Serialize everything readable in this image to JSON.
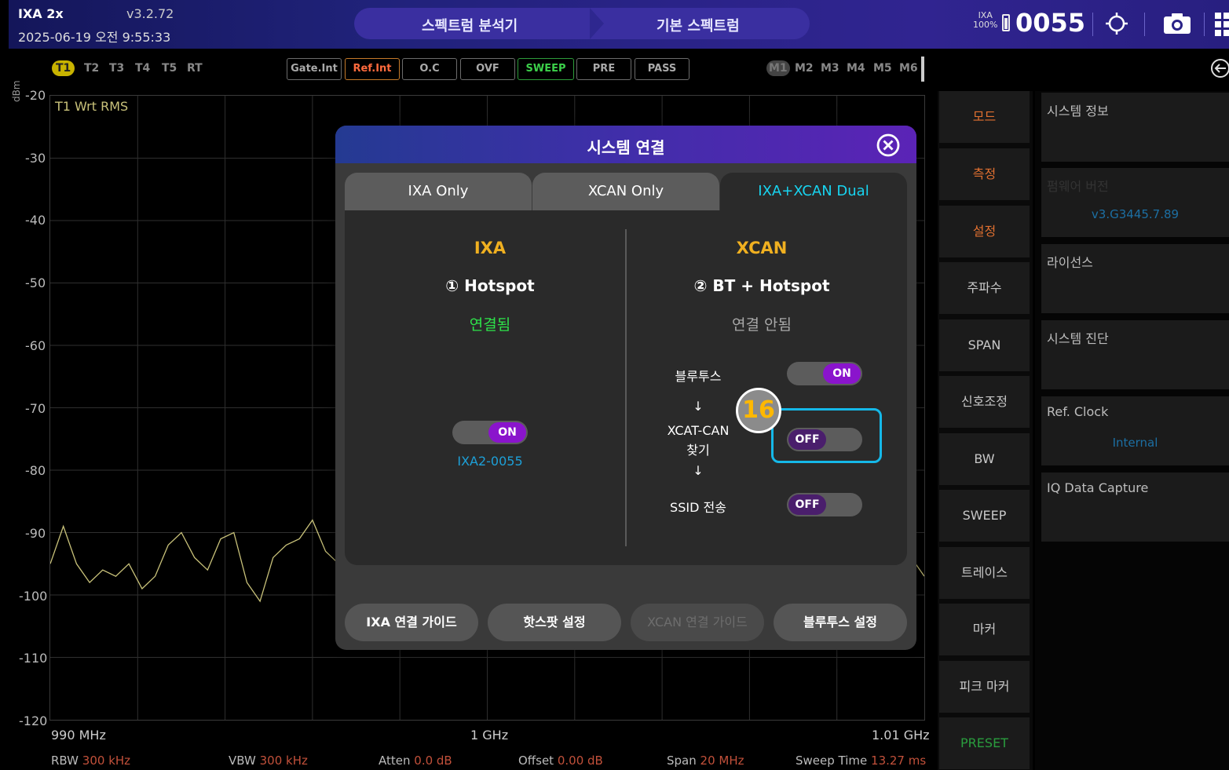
{
  "header": {
    "app_name": "IXA 2x",
    "version": "v3.2.72",
    "datetime": "2025-06-19 오전 9:55:33",
    "breadcrumb": [
      "스펙트럼 분석기",
      "기본 스펙트럼"
    ],
    "ixa_badge": "IXA",
    "battery_percent": "100%",
    "serial": "0055",
    "icons": [
      "battery-icon",
      "target-icon",
      "camera-icon",
      "grid-menu-icon"
    ]
  },
  "chart_toolbar": {
    "traces": [
      "T1",
      "T2",
      "T3",
      "T4",
      "T5",
      "RT"
    ],
    "active_trace": "T1",
    "status": [
      "Gate.Int",
      "Ref.Int",
      "O.C",
      "OVF",
      "SWEEP",
      "PRE",
      "PASS"
    ],
    "markers": [
      "M1",
      "M2",
      "M3",
      "M4",
      "M5",
      "M6"
    ],
    "active_marker": "M1"
  },
  "chart_data": {
    "type": "line",
    "title": "",
    "trace_label": "T1 Wrt RMS",
    "ylabel": "dBm",
    "ylim": [
      -120,
      -20
    ],
    "yticks": [
      "-20",
      "-30",
      "-40",
      "-50",
      "-60",
      "-70",
      "-80",
      "-90",
      "-100",
      "-110",
      "-120"
    ],
    "xticks": [
      "990 MHz",
      "1 GHz",
      "1.01 GHz"
    ],
    "grid": true,
    "series": [
      {
        "x_mhz": [
          990.0,
          990.3,
          990.6,
          990.9,
          991.2,
          991.5,
          991.8,
          992.1,
          992.4,
          992.7,
          993.0,
          993.3,
          993.6,
          993.9,
          994.2,
          994.5,
          994.8,
          995.1,
          995.4,
          995.7,
          996.0,
          996.3,
          996.6,
          996.9,
          997.2,
          997.5,
          997.8,
          998.1,
          998.4,
          998.7,
          999.0,
          999.3,
          999.6,
          1009.0,
          1009.3,
          1009.6,
          1010.0
        ],
        "y_dbm": [
          -95,
          -89,
          -95,
          -98,
          -96,
          -97,
          -95,
          -99,
          -97,
          -92,
          -90,
          -94,
          -96,
          -91,
          -90,
          -98,
          -101,
          -94,
          -92,
          -91,
          -88,
          -93,
          -95,
          -92,
          -97,
          -93,
          -96,
          -99,
          -95,
          -92,
          -89,
          -92,
          -94,
          -92,
          -91,
          -93,
          -97
        ]
      }
    ]
  },
  "footer": {
    "rbw_label": "RBW",
    "rbw": "300 kHz",
    "vbw_label": "VBW",
    "vbw": "300 kHz",
    "atten_label": "Atten",
    "atten": "0.0 dB",
    "offset_label": "Offset",
    "offset": "0.00 dB",
    "span_label": "Span",
    "span": "20 MHz",
    "sweep_label": "Sweep Time",
    "sweep": "13.27 ms"
  },
  "side_menu": [
    "모드",
    "측정",
    "설정",
    "주파수",
    "SPAN",
    "신호조정",
    "BW",
    "SWEEP",
    "트레이스",
    "마커",
    "피크 마커",
    "PRESET"
  ],
  "system_panel": {
    "system_info": "시스템 정보",
    "firmware_label": "펌웨어 버전",
    "firmware_value": "v3.G3445.7.89",
    "license": "라이선스",
    "diagnostics": "시스템 진단",
    "ref_clock_label": "Ref. Clock",
    "ref_clock_value": "Internal",
    "iq_capture": "IQ Data Capture"
  },
  "dialog": {
    "title": "시스템 연결",
    "tabs": [
      "IXA Only",
      "XCAN Only",
      "IXA+XCAN Dual"
    ],
    "active_tab": "IXA+XCAN Dual",
    "ixa": {
      "title": "IXA",
      "mode": "① Hotspot",
      "status": "연결됨",
      "toggle": "ON",
      "ssid": "IXA2-0055"
    },
    "xcan": {
      "title": "XCAN",
      "mode": "② BT + Hotspot",
      "status": "연결 안됨",
      "bluetooth_label": "블루투스",
      "bluetooth_toggle": "ON",
      "arrow": "↓",
      "find_label_line1": "XCAT-CAN",
      "find_label_line2": "찾기",
      "find_toggle": "OFF",
      "ssid_label": "SSID 전송",
      "ssid_toggle": "OFF"
    },
    "buttons": [
      "IXA 연결 가이드",
      "핫스팟 설정",
      "XCAN 연결 가이드",
      "블루투스 설정"
    ],
    "step_badge": "16"
  },
  "colors": {
    "accent_cyan": "#18d4f0",
    "title_gold": "#f0b020",
    "toggle_purple": "#8a14cc",
    "connected_green": "#2ee24a",
    "trace_yellow": "#c9c27a"
  }
}
